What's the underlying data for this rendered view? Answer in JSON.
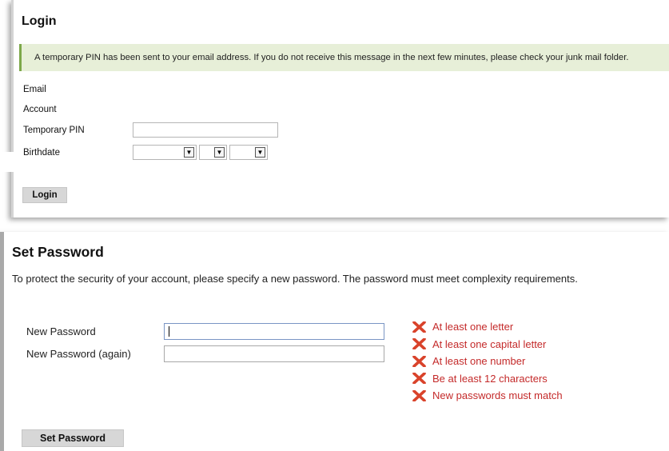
{
  "login": {
    "title": "Login",
    "alert": "A temporary PIN has been sent to your email address. If you do not receive this message in the next few minutes, please check your junk mail folder.",
    "fields": {
      "email_label": "Email",
      "account_label": "Account",
      "pin_label": "Temporary PIN",
      "pin_value": "",
      "birthdate_label": "Birthdate"
    },
    "birthdate_selects": [
      "",
      "",
      ""
    ],
    "button_label": "Login"
  },
  "set_password": {
    "title": "Set Password",
    "description": "To protect the security of your account, please specify a new password. The password must meet complexity requirements.",
    "new_password_label": "New Password",
    "new_password_again_label": "New Password (again)",
    "requirements": [
      {
        "label": "At least one letter",
        "status": "failed",
        "icon": "x-mark-icon"
      },
      {
        "label": "At least one capital letter",
        "status": "failed",
        "icon": "x-mark-icon"
      },
      {
        "label": "At least one number",
        "status": "failed",
        "icon": "x-mark-icon"
      },
      {
        "label": "Be at least 12 characters",
        "status": "failed",
        "icon": "x-mark-icon"
      },
      {
        "label": "New passwords must match",
        "status": "failed",
        "icon": "x-mark-icon"
      }
    ],
    "button_label": "Set Password"
  },
  "colors": {
    "alert_background": "#e7efd8",
    "alert_border": "#7da84a",
    "requirement_failed": "#c42a2a",
    "button_background": "#d7d7d7"
  }
}
